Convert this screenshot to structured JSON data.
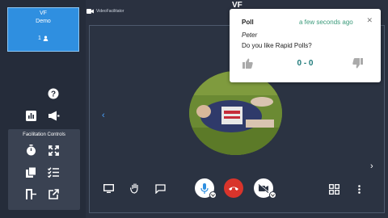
{
  "sidebar": {
    "user_card": {
      "initials": "VF",
      "room": "Demo",
      "participant_count": "1"
    },
    "facilitation_title": "Facilitation Controls"
  },
  "header": {
    "label": "VideoFacilitator",
    "brand": "VF"
  },
  "poll": {
    "title": "Poll",
    "time": "a few seconds ago",
    "author": "Peter",
    "question": "Do you like Rapid Polls?",
    "score": "0 - 0"
  },
  "colors": {
    "accent": "#2f8fe0",
    "end_call": "#d9342b",
    "poll_time": "#3a9a7a",
    "score": "#1f7a7a"
  }
}
